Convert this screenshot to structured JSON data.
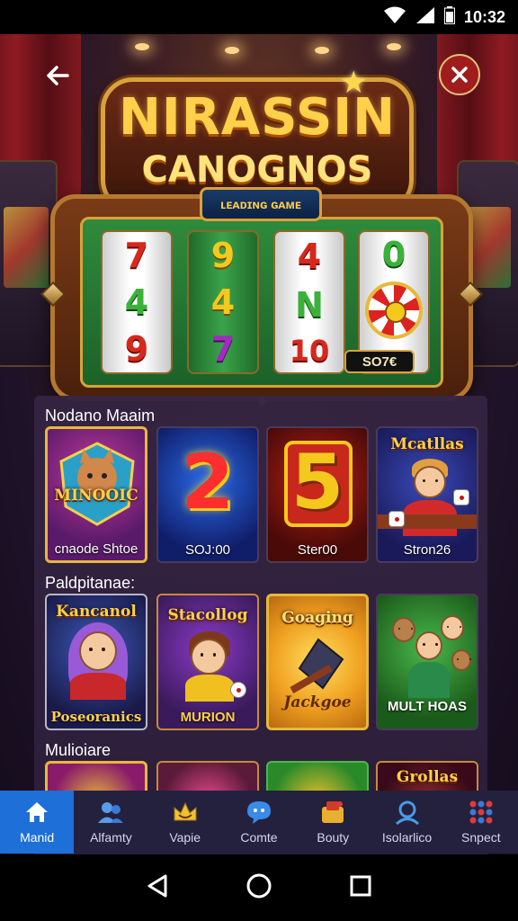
{
  "status_bar": {
    "time": "10:32",
    "icons": [
      "wifi-icon",
      "signal-icon",
      "battery-icon"
    ]
  },
  "header": {
    "back_icon": "back-arrow-icon",
    "close_icon": "close-icon"
  },
  "logo": {
    "line1": "NIRASSIN",
    "line2": "CANOGNOS",
    "ribbon": "ʟᴇᴀᴅɪɴɢ ɢᴀᴍᴇ"
  },
  "slot_machine": {
    "reels": [
      [
        "7",
        "4",
        "9"
      ],
      [
        "9",
        "4",
        "7"
      ],
      [
        "4",
        "N",
        "10"
      ],
      [
        "0",
        "wheel"
      ]
    ],
    "credit": "SO7€"
  },
  "sections": [
    {
      "title": "Nodano Maaim",
      "games": [
        {
          "title": "MINOOIC",
          "label": "cnaode Shtoe"
        },
        {
          "title": "2",
          "label": "SOJ:00"
        },
        {
          "title": "5",
          "label": "Ster00"
        },
        {
          "title": "Mcatllas",
          "label": "Stron26"
        }
      ]
    },
    {
      "title": "Paldpitanae:",
      "games": [
        {
          "title": "Kancanol",
          "label": "Poseoranics"
        },
        {
          "title": "Stacollog",
          "label": "MURION"
        },
        {
          "title": "Goaging",
          "label": "Jackgoe"
        },
        {
          "title": "",
          "label": "MULT HOAS"
        }
      ]
    },
    {
      "title": "Mulioiare",
      "games": [
        {
          "title": "",
          "label": ""
        },
        {
          "title": "",
          "label": ""
        },
        {
          "title": "",
          "label": ""
        },
        {
          "title": "Grollas",
          "label": ""
        }
      ]
    }
  ],
  "bottom_nav": [
    {
      "label": "Manid",
      "icon": "home-icon",
      "active": true
    },
    {
      "label": "Alfamty",
      "icon": "people-icon",
      "active": false
    },
    {
      "label": "Vapie",
      "icon": "crown-icon",
      "active": false
    },
    {
      "label": "Comte",
      "icon": "chat-icon",
      "active": false
    },
    {
      "label": "Bouty",
      "icon": "gift-icon",
      "active": false
    },
    {
      "label": "Isolarlico",
      "icon": "user-search-icon",
      "active": false
    },
    {
      "label": "Snpect",
      "icon": "grid-icon",
      "active": false
    }
  ],
  "colors": {
    "accent_blue": "#1e6fd8",
    "gold": "#e8b83a",
    "nav_bg": "#24213e",
    "panel_bg": "#34244a",
    "close_red": "#a11c1c"
  }
}
